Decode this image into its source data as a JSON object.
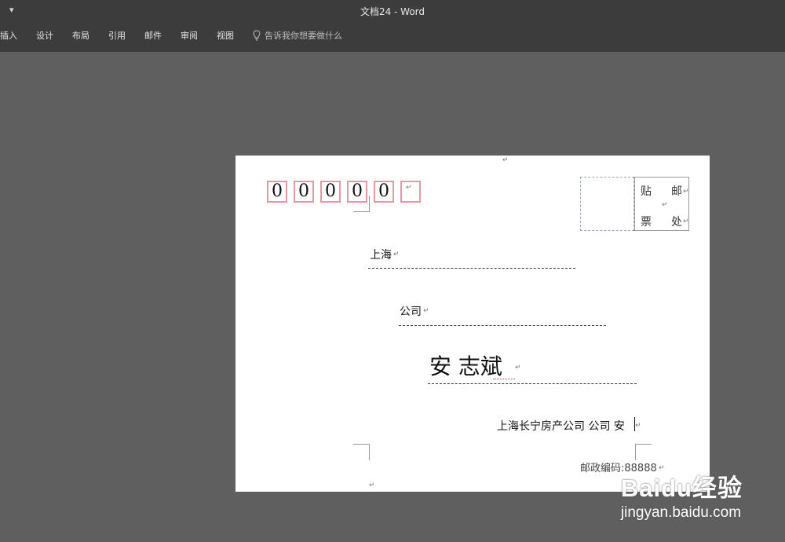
{
  "titlebar": {
    "quick_access": "▾",
    "title": "文档24  -  Word"
  },
  "ribbon": {
    "tabs": [
      "插入",
      "设计",
      "布局",
      "引用",
      "邮件",
      "审阅",
      "视图"
    ],
    "tell_me": "告诉我你想要做什么"
  },
  "envelope": {
    "postcode_digits": [
      "0",
      "0",
      "0",
      "0",
      "0",
      ""
    ],
    "stamp": {
      "chars": [
        "贴",
        "邮",
        "票",
        "处"
      ]
    },
    "address_city": "上海",
    "address_company": "公司",
    "recipient_name": "安 志斌",
    "sender_line": "上海长宁房产公司 公司 安",
    "sender_postcode": "邮政编码:88888"
  },
  "watermark": {
    "logo": "Baidu经验",
    "url": "jingyan.baidu.com"
  },
  "marks": {
    "para": "↵"
  }
}
